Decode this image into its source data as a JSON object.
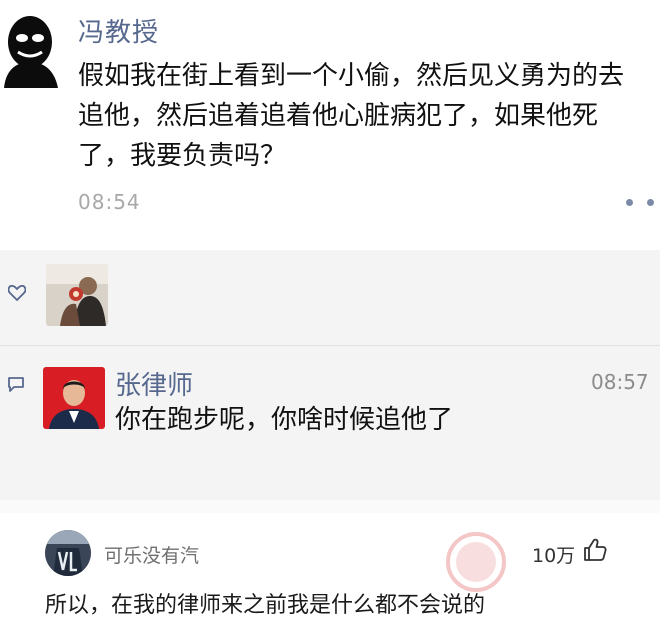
{
  "post": {
    "author": "冯教授",
    "body": "假如我在街上看到一个小偷，然后见义勇为的去追他，然后追着追着他心脏病犯了，如果他死了，我要负责吗？",
    "time": "08:54",
    "more_icon": "more-dots-icon"
  },
  "likes": {
    "icon": "heart-icon"
  },
  "comment": {
    "icon": "comment-bubble-icon",
    "author": "张律师",
    "time": "08:57",
    "text": "你在跑步呢，你啥时候追他了"
  },
  "reply": {
    "author": "可乐没有汽",
    "like_count": "10万",
    "like_icon": "thumbs-up-icon",
    "text": "所以，在我的律师来之前我是什么都不会说的"
  },
  "colors": {
    "name_blue": "#56688e",
    "panel_gray": "#f4f4f4",
    "stamp_red": "#d93a3a"
  }
}
